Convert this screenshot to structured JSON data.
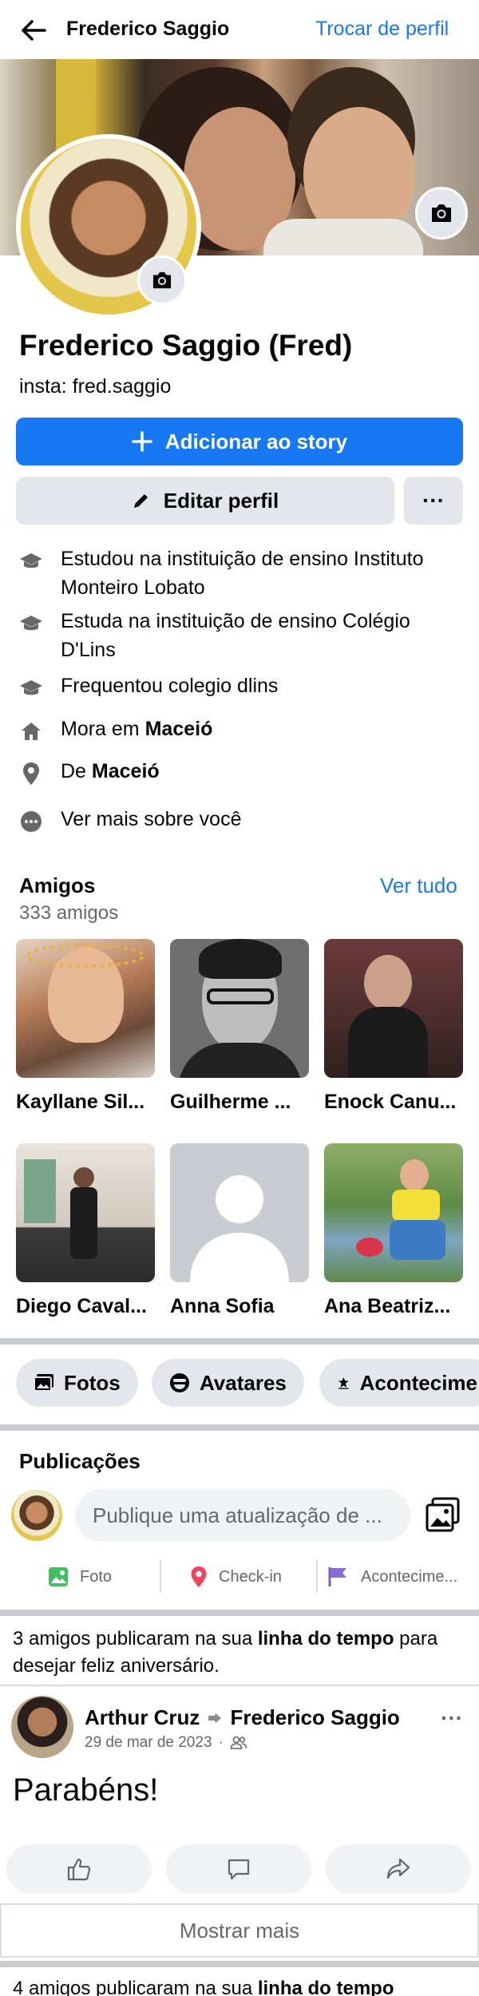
{
  "header": {
    "title": "Frederico Saggio",
    "switch_profile": "Trocar de perfil"
  },
  "profile": {
    "name": "Frederico Saggio (Fred)",
    "bio": "insta: fred.saggio"
  },
  "actions": {
    "add_story": "Adicionar ao story",
    "edit_profile": "Editar perfil",
    "more": "···"
  },
  "info": [
    {
      "icon": "graduation-cap-icon",
      "text": "Estudou na instituição de ensino Instituto Monteiro Lobato"
    },
    {
      "icon": "graduation-cap-icon",
      "text": "Estuda na instituição de ensino Colégio D'Lins"
    },
    {
      "icon": "graduation-cap-icon",
      "text": "Frequentou colegio dlins"
    },
    {
      "icon": "home-icon",
      "prefix": "Mora em ",
      "bold": "Maceió"
    },
    {
      "icon": "location-pin-icon",
      "prefix": "De ",
      "bold": "Maceió"
    },
    {
      "icon": "more-dots-icon",
      "text": "Ver mais sobre você"
    }
  ],
  "friends": {
    "title": "Amigos",
    "count": "333 amigos",
    "see_all": "Ver tudo",
    "items": [
      {
        "name": "Kayllane Sil..."
      },
      {
        "name": "Guilherme ..."
      },
      {
        "name": "Enock Canu..."
      },
      {
        "name": "Diego Caval..."
      },
      {
        "name": "Anna Sofia"
      },
      {
        "name": "Ana Beatriz..."
      }
    ]
  },
  "chips": {
    "photos": "Fotos",
    "avatars": "Avatares",
    "events": "Acontecime"
  },
  "posts": {
    "title": "Publicações",
    "composer_placeholder": "Publique uma atualização de ...",
    "photo": "Foto",
    "checkin": "Check-in",
    "event": "Acontecime..."
  },
  "timeline_notice": {
    "prefix": "3 amigos publicaram na sua ",
    "bold": "linha do tempo",
    "suffix": " para desejar feliz aniversário."
  },
  "post": {
    "author": "Arthur Cruz",
    "target": "Frederico Saggio",
    "date": "29 de mar de 2023",
    "separator": "·",
    "body": "Parabéns!",
    "menu": "···"
  },
  "show_more": "Mostrar mais",
  "timeline_notice2": {
    "prefix": "4 amigos publicaram na sua ",
    "bold": "linha do tempo"
  },
  "colors": {
    "accent": "#1877f2",
    "secondary_bg": "#e4e6eb",
    "muted_text": "#65676b"
  }
}
